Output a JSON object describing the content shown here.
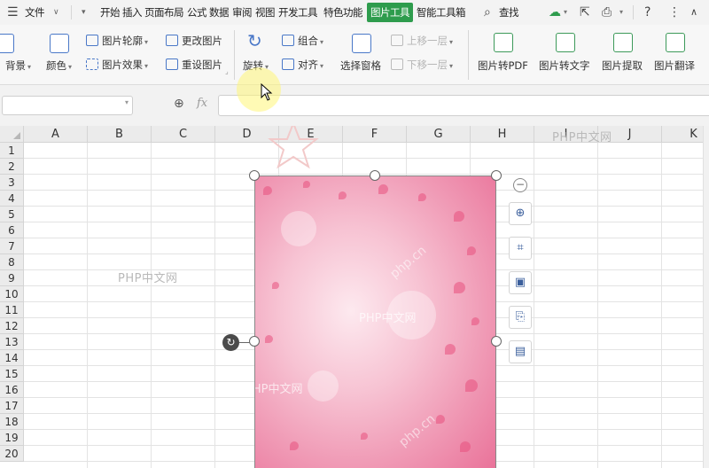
{
  "menubar": {
    "file_label": "文件",
    "tabs": [
      "开始",
      "插入",
      "页面布局",
      "公式",
      "数据",
      "审阅",
      "视图",
      "开发工具",
      "特色功能",
      "图片工具",
      "智能工具箱"
    ],
    "active_tab": "图片工具",
    "search_label": "查找"
  },
  "ribbon": {
    "left_partial": [
      "背景",
      "颜色"
    ],
    "picture_outline": "图片轮廓",
    "picture_effects": "图片效果",
    "change_picture": "更改图片",
    "reset_picture": "重设图片",
    "rotate": "旋转",
    "group": "组合",
    "align": "对齐",
    "selection_pane": "选择窗格",
    "bring_forward": "上移一层",
    "send_backward": "下移一层",
    "to_pdf": "图片转PDF",
    "to_text": "图片转文字",
    "extract": "图片提取",
    "translate": "图片翻译"
  },
  "formula_bar": {
    "name_box_value": "",
    "fx_label": "fx",
    "formula_value": ""
  },
  "sheet": {
    "columns": [
      "A",
      "B",
      "C",
      "D",
      "E",
      "F",
      "G",
      "H",
      "I",
      "J",
      "K"
    ],
    "rows": [
      "1",
      "2",
      "3",
      "4",
      "5",
      "6",
      "7",
      "8",
      "9",
      "10",
      "11",
      "12",
      "13",
      "14",
      "15",
      "16",
      "17",
      "18",
      "19",
      "20"
    ],
    "watermarks": [
      "PHP中文网",
      "PHP中文网",
      "PHP中文网",
      "PHP中文网"
    ],
    "image_watermark": "php.cn"
  },
  "colors": {
    "active_tab": "#2e9c4d",
    "picture_pink": "#f09bb6",
    "icon_blue": "#4a78c8",
    "icon_green": "#3d9a5a"
  }
}
